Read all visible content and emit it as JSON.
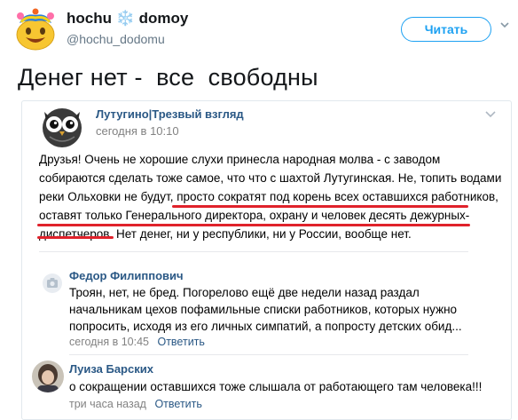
{
  "tweet": {
    "name_part1": "hochu",
    "name_snowflake": "❄️",
    "name_part2": "domoy",
    "handle": "@hochu_dodomu",
    "follow_label": "Читать",
    "text": "Денег нет -  все  свободны"
  },
  "vk_post": {
    "group_name": "Лутугино|Трезвый взгляд",
    "time": "сегодня в 10:10",
    "lines": [
      "Друзья! Очень не хорошие слухи принесла народная молва - с заводом",
      "собираются сделать тоже самое, что что с шахтой Лутугинская. Не, топить водами",
      "реки Ольховки не будут, просто сократят под корень всех оставшихся работников,",
      "оставят только Генерального директора, охрану и человек десять дежурных-",
      "диспетчеров. Нет денег, ни у республики, ни у России, вообще нет."
    ]
  },
  "comments": [
    {
      "author": "Федор Филиппович",
      "lines": [
        "Троян, нет, не бред. Погорелово ещё две недели назад раздал",
        "начальникам цехов пофамильные списки работников, которых нужно",
        "попросить, исходя из его личных симпатий, а попросту детских обид..."
      ],
      "time": "сегодня в 10:45",
      "reply_label": "Ответить"
    },
    {
      "author": "Луиза Барских",
      "text": "о сокращении оставшихся тоже слышала от работающего там человека!!!",
      "time": "три часа назад",
      "reply_label": "Ответить"
    }
  ],
  "colors": {
    "twitter_blue": "#1da1f2",
    "vk_link": "#2a5885",
    "underline_red": "#e0222b",
    "muted": "#828282"
  }
}
